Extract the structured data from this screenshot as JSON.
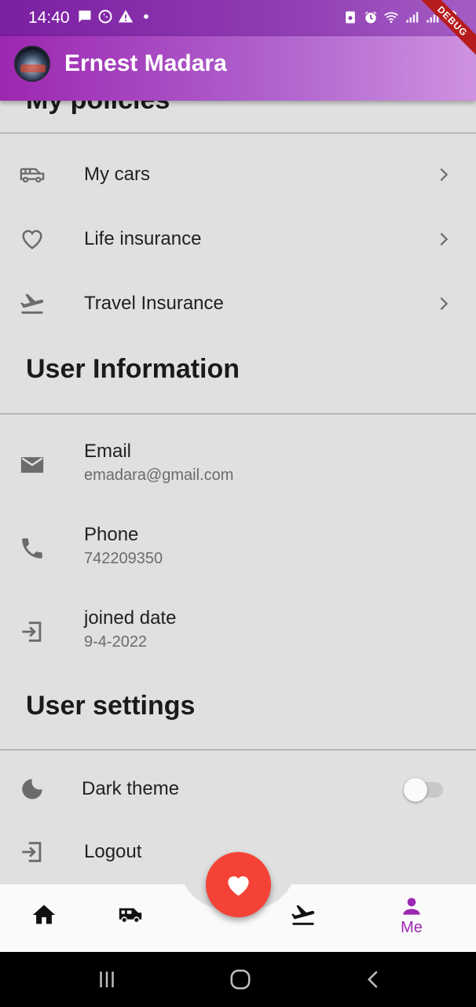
{
  "status_bar": {
    "time": "14:40",
    "left_icons": [
      "message-icon",
      "whatsapp-icon",
      "warning-icon",
      "dot-icon"
    ],
    "right_icons": [
      "recycle-icon",
      "alarm-icon",
      "wifi-icon",
      "signal-icon",
      "signal-icon",
      "battery-icon"
    ]
  },
  "app_bar": {
    "title": "Ernest Madara",
    "debug_label": "DEBUG"
  },
  "policies": {
    "items": [
      {
        "label": "My cars",
        "icon": "car-icon"
      },
      {
        "label": "Life insurance",
        "icon": "heart-outline-icon"
      },
      {
        "label": "Travel Insurance",
        "icon": "flight-takeoff-icon"
      }
    ]
  },
  "user_information": {
    "heading": "User Information",
    "items": [
      {
        "title": "Email",
        "value": "emadara@gmail.com",
        "icon": "mail-icon"
      },
      {
        "title": "Phone",
        "value": "742209350",
        "icon": "phone-icon"
      },
      {
        "title": "joined date",
        "value": "9-4-2022",
        "icon": "login-icon"
      }
    ]
  },
  "user_settings": {
    "heading": "User settings",
    "dark_theme_label": "Dark theme",
    "dark_theme_on": false,
    "logout_label": "Logout"
  },
  "bottom_nav": {
    "items": [
      "home-icon",
      "car-icon",
      "flight-takeoff-icon",
      "person-icon"
    ],
    "me_label": "Me",
    "active": "Me",
    "accent_color": "#9c27b0",
    "fab_icon": "heart-icon",
    "fab_color": "#f44336"
  },
  "system_nav": [
    "recent-apps-icon",
    "home-circle-icon",
    "back-icon"
  ]
}
